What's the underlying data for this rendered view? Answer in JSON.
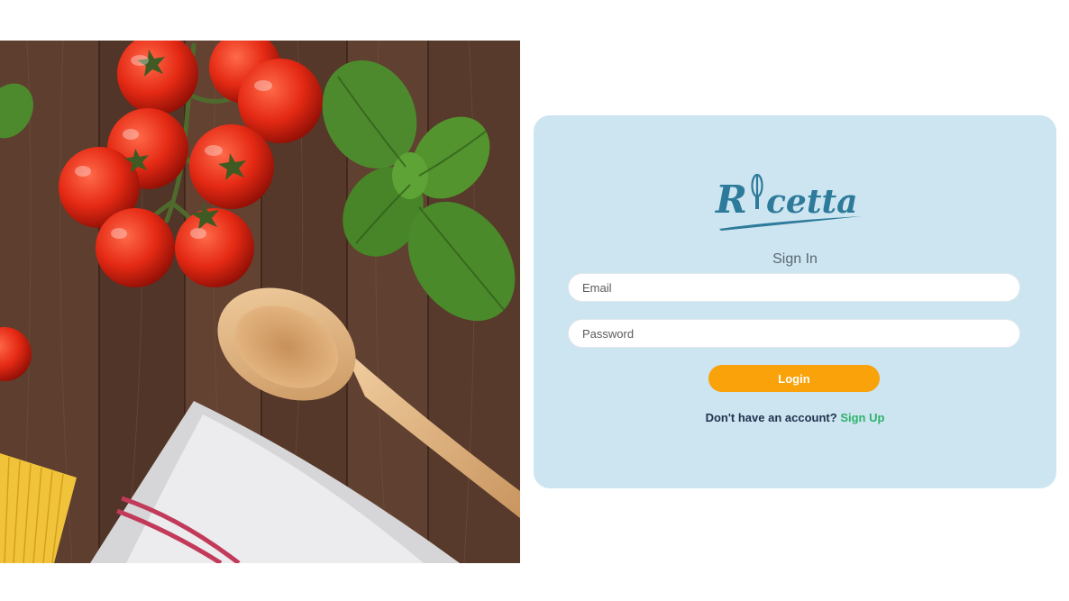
{
  "brand": {
    "logo_text": "Ricetta",
    "colors": {
      "logo": "#2e7a9b",
      "accent": "#f9a20a",
      "link": "#2fb36a",
      "card": "#cce5f0"
    }
  },
  "hero_image": {
    "icon": "food-photo",
    "items": [
      "cherry-tomatoes",
      "basil-leaves",
      "wooden-spoon",
      "kitchen-towel",
      "spaghetti"
    ]
  },
  "login_form": {
    "title": "Sign In",
    "email": {
      "placeholder": "Email",
      "value": ""
    },
    "password": {
      "placeholder": "Password",
      "value": ""
    },
    "login_label": "Login",
    "signup_prompt": "Don't have an account?",
    "signup_link": "Sign Up"
  }
}
